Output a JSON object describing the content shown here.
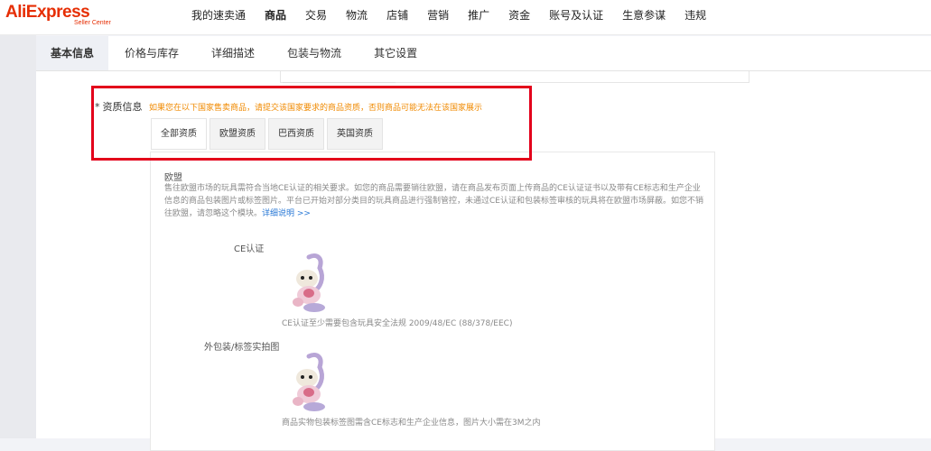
{
  "header": {
    "logo_main": "AliExpress",
    "logo_sub": "Seller Center",
    "nav": [
      "我的速卖通",
      "商品",
      "交易",
      "物流",
      "店铺",
      "营销",
      "推广",
      "资金",
      "账号及认证",
      "生意参谋",
      "违规"
    ],
    "active_nav_index": 1
  },
  "tabs": {
    "items": [
      "基本信息",
      "价格与库存",
      "详细描述",
      "包装与物流",
      "其它设置"
    ],
    "active_index": 0
  },
  "qualification": {
    "required_mark": "*",
    "label": "资质信息",
    "hint": "如果您在以下国家售卖商品，请提交该国家要求的商品资质，否则商品可能无法在该国家展示",
    "subtabs": [
      "全部资质",
      "欧盟资质",
      "巴西资质",
      "英国资质"
    ]
  },
  "eu_section": {
    "title": "欧盟",
    "description": "售往欧盟市场的玩具需符合当地CE认证的相关要求。如您的商品需要销往欧盟，请在商品发布页面上传商品的CE认证证书以及带有CE标志和生产企业信息的商品包装图片或标签图片。平台已开始对部分类目的玩具商品进行强制管控，未通过CE认证和包装标签审核的玩具将在欧盟市场屏蔽。如您不销往欧盟，请忽略这个模块。",
    "more_link": "详细说明 >>",
    "items": [
      {
        "label": "CE认证",
        "caption": "CE认证至少需要包含玩具安全法规 2009/48/EC (88/378/EEC)"
      },
      {
        "label": "外包装/标签实拍图",
        "caption": "商品实物包装标签图需含CE标志和生产企业信息，图片大小需在3M之内"
      }
    ]
  },
  "colors": {
    "brand": "#e62e04",
    "hint": "#f08a00",
    "highlight_box": "#e3001b",
    "link": "#2a79d6"
  }
}
